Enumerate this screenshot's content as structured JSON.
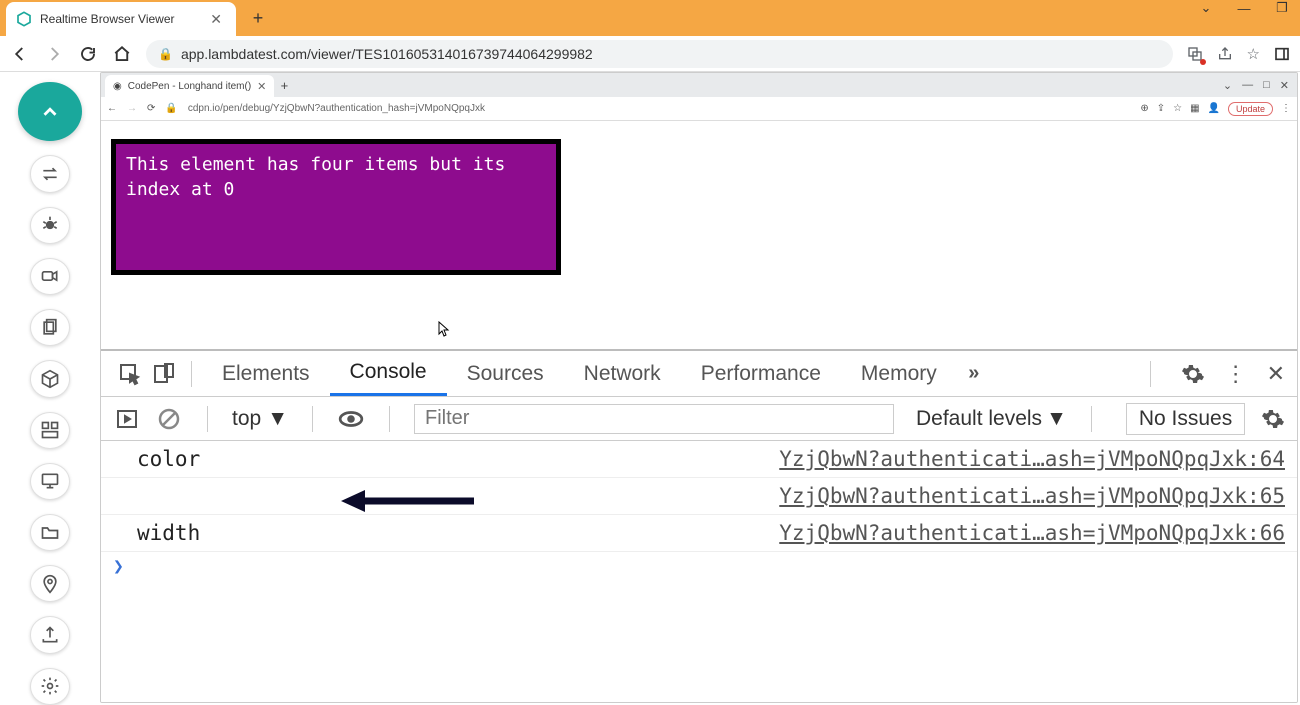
{
  "outer_browser": {
    "tab_title": "Realtime Browser Viewer",
    "url": "app.lambdatest.com/viewer/TES101605314016739744064299982"
  },
  "inner_browser": {
    "tab_title": "CodePen - Longhand item()",
    "url": "cdpn.io/pen/debug/YzjQbwN?authentication_hash=jVMpoNQpqJxk",
    "update_label": "Update"
  },
  "page": {
    "box_text": "This element has four items but its index at 0"
  },
  "devtools": {
    "tabs": {
      "elements": "Elements",
      "console": "Console",
      "sources": "Sources",
      "network": "Network",
      "performance": "Performance",
      "memory": "Memory"
    },
    "toolbar": {
      "context": "top",
      "filter_placeholder": "Filter",
      "levels": "Default levels",
      "issues": "No Issues"
    },
    "logs": [
      {
        "msg": "color",
        "src": "YzjQbwN?authenticati…ash=jVMpoNQpqJxk:64"
      },
      {
        "msg": "",
        "src": "YzjQbwN?authenticati…ash=jVMpoNQpqJxk:65"
      },
      {
        "msg": "width",
        "src": "YzjQbwN?authenticati…ash=jVMpoNQpqJxk:66"
      }
    ]
  }
}
